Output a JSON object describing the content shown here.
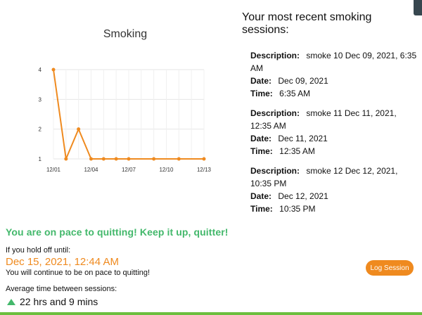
{
  "chart_title": "Smoking",
  "chart_data": {
    "type": "line",
    "title": "Smoking",
    "x": [
      "12/01",
      "12/02",
      "12/03",
      "12/04",
      "12/05",
      "12/06",
      "12/07",
      "12/08",
      "12/09",
      "12/10",
      "12/11",
      "12/12",
      "12/13"
    ],
    "xticks": [
      "12/01",
      "12/04",
      "12/07",
      "12/10",
      "12/13"
    ],
    "series": [
      {
        "values": [
          4,
          1,
          2,
          1,
          1,
          1,
          1,
          null,
          1,
          null,
          1,
          null,
          1
        ]
      }
    ],
    "ylim": [
      1,
      4
    ],
    "yticks": [
      1,
      2,
      3,
      4
    ],
    "grid": true,
    "color": "#ef8a1f"
  },
  "sessions": {
    "title": "Your most recent smoking sessions:",
    "labels": {
      "description": "Description:",
      "date": "Date:",
      "time": "Time:"
    },
    "items": [
      {
        "description": "smoke 10 Dec 09, 2021, 6:35 AM",
        "date": "Dec 09, 2021",
        "time": "6:35 AM"
      },
      {
        "description": "smoke 11 Dec 11, 2021, 12:35 AM",
        "date": "Dec 11, 2021",
        "time": "12:35 AM"
      },
      {
        "description": "smoke 12 Dec 12, 2021, 10:35 PM",
        "date": "Dec 12, 2021",
        "time": "10:35 PM"
      }
    ]
  },
  "status": {
    "pace_message": "You are on pace to quitting! Keep it up, quitter!",
    "holdoff_label": "If you hold off until:",
    "holdoff_date": "Dec 15, 2021, 12:44 AM",
    "continue_message": "You will continue to be on pace to quitting!",
    "avg_label": "Average time between sessions:",
    "avg_value": "22 hrs and 9 mins",
    "trend_icon": "triangle-up-icon"
  },
  "log_button": "Log Session",
  "colors": {
    "accent": "#ef8a1f",
    "success": "#43b86b"
  }
}
